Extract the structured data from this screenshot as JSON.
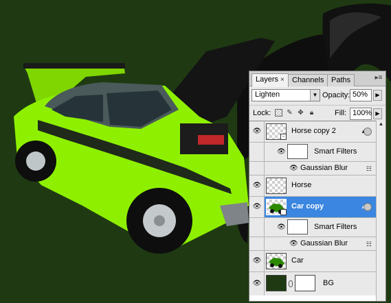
{
  "panel": {
    "tabs": [
      {
        "label": "Layers",
        "close": "×"
      },
      {
        "label": "Channels"
      },
      {
        "label": "Paths"
      }
    ],
    "menu_icon": "panel-menu-icon",
    "blend_mode": "Lighten",
    "opacity_label": "Opacity:",
    "opacity_value": "50%",
    "lock_label": "Lock:",
    "fill_label": "Fill:",
    "fill_value": "100%"
  },
  "layers": [
    {
      "name": "Horse copy 2",
      "visible": true,
      "type": "smart-object",
      "has_filters": true
    },
    {
      "name": "Smart Filters",
      "sub": true
    },
    {
      "name": "Gaussian Blur",
      "sub": true,
      "filter": true
    },
    {
      "name": "Horse",
      "visible": true,
      "type": "pixel"
    },
    {
      "name": "Car copy",
      "visible": true,
      "type": "smart-object",
      "selected": true,
      "has_filters": true
    },
    {
      "name": "Smart Filters",
      "sub": true
    },
    {
      "name": "Gaussian Blur",
      "sub": true,
      "filter": true
    },
    {
      "name": "Car",
      "visible": true,
      "type": "pixel"
    },
    {
      "name": "BG",
      "visible": true,
      "type": "fill-with-mask"
    }
  ],
  "colors": {
    "background": "#1f3a12",
    "car_body": "#8ef000",
    "selection": "#3a86e0"
  }
}
